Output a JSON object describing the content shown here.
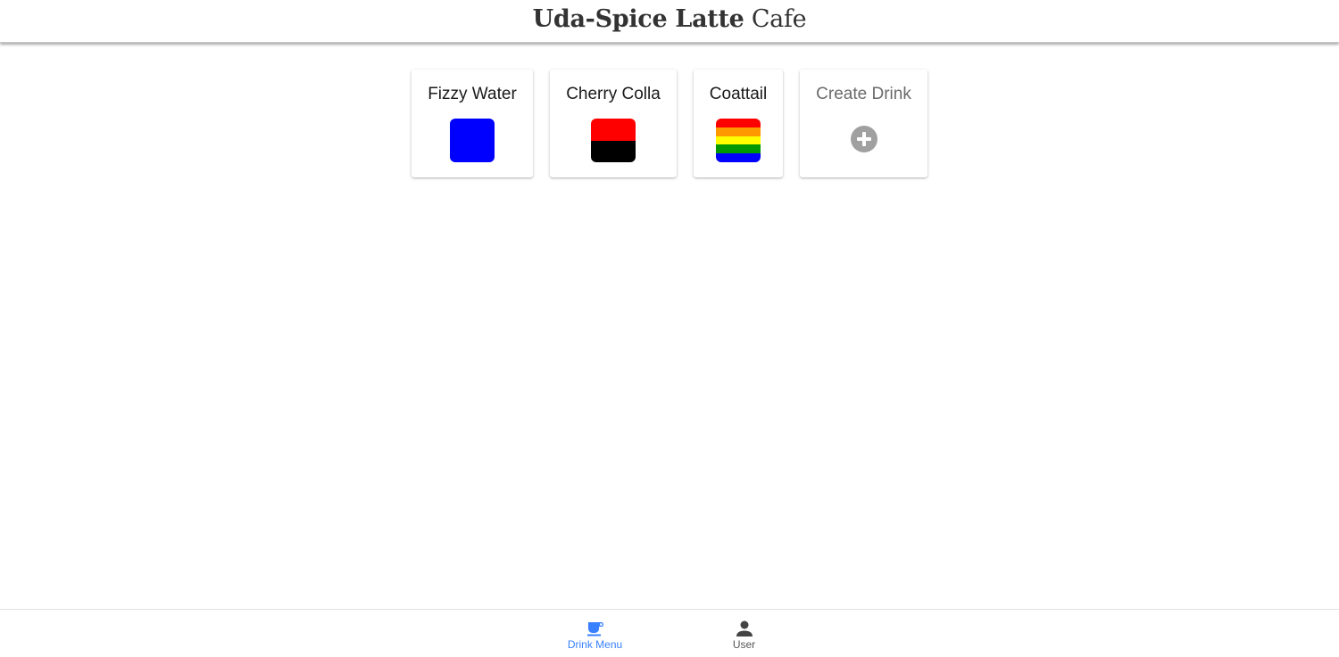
{
  "header": {
    "title_bold": "Uda-Spice Latte",
    "title_light": "Cafe"
  },
  "drinks": [
    {
      "name": "Fizzy Water",
      "bands": [
        "#0000ff"
      ]
    },
    {
      "name": "Cherry Colla",
      "bands": [
        "#ff0000",
        "#000000"
      ]
    },
    {
      "name": "Coattail",
      "bands": [
        "#ff0000",
        "#ff9900",
        "#ffff00",
        "#009900",
        "#0000ff"
      ]
    }
  ],
  "create_drink": {
    "label": "Create Drink",
    "icon": "add-circle-icon",
    "icon_color": "#a0a0a0"
  },
  "tabs": [
    {
      "label": "Drink Menu",
      "icon": "cafe-icon",
      "active": true
    },
    {
      "label": "User",
      "icon": "person-icon",
      "active": false
    }
  ],
  "colors": {
    "accent": "#3880ff",
    "inactive": "#555555"
  }
}
